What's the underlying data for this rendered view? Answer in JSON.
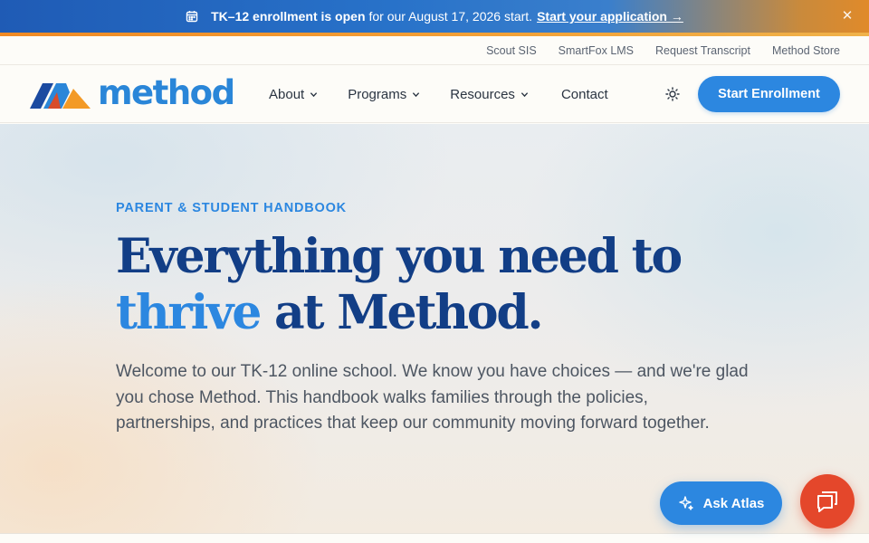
{
  "announcement": {
    "bold_text": "TK–12 enrollment is open",
    "rest_text": "for our August 17, 2026 start.",
    "link_text": "Start your application →",
    "close_glyph": "✕",
    "icon": "calendar-icon"
  },
  "utility_nav": {
    "items": [
      {
        "label": "Scout SIS"
      },
      {
        "label": "SmartFox LMS"
      },
      {
        "label": "Request Transcript"
      },
      {
        "label": "Method Store"
      }
    ]
  },
  "main_nav": {
    "logo_text": "method",
    "items": [
      {
        "label": "About",
        "has_dropdown": true
      },
      {
        "label": "Programs",
        "has_dropdown": true
      },
      {
        "label": "Resources",
        "has_dropdown": true
      },
      {
        "label": "Contact",
        "has_dropdown": false
      }
    ],
    "theme_icon": "sun-icon",
    "cta_label": "Start Enrollment"
  },
  "hero": {
    "eyebrow": "PARENT & STUDENT HANDBOOK",
    "headline_line1": "Everything you need to",
    "headline_accent": "thrive",
    "headline_rest": " at Method.",
    "lead": "Welcome to our TK-12 online school. We know you have choices — and we're glad you chose Method. This handbook walks families through the policies, partnerships, and practices that keep our community moving forward together."
  },
  "floating": {
    "ask_label": "Ask Atlas",
    "ask_icon": "sparkle-icon",
    "chat_icon": "chat-icon"
  },
  "colors": {
    "brand_blue": "#2c87e0",
    "navy": "#123e86",
    "chat_red": "#e4472b",
    "announce_orange": "#f08a24"
  }
}
